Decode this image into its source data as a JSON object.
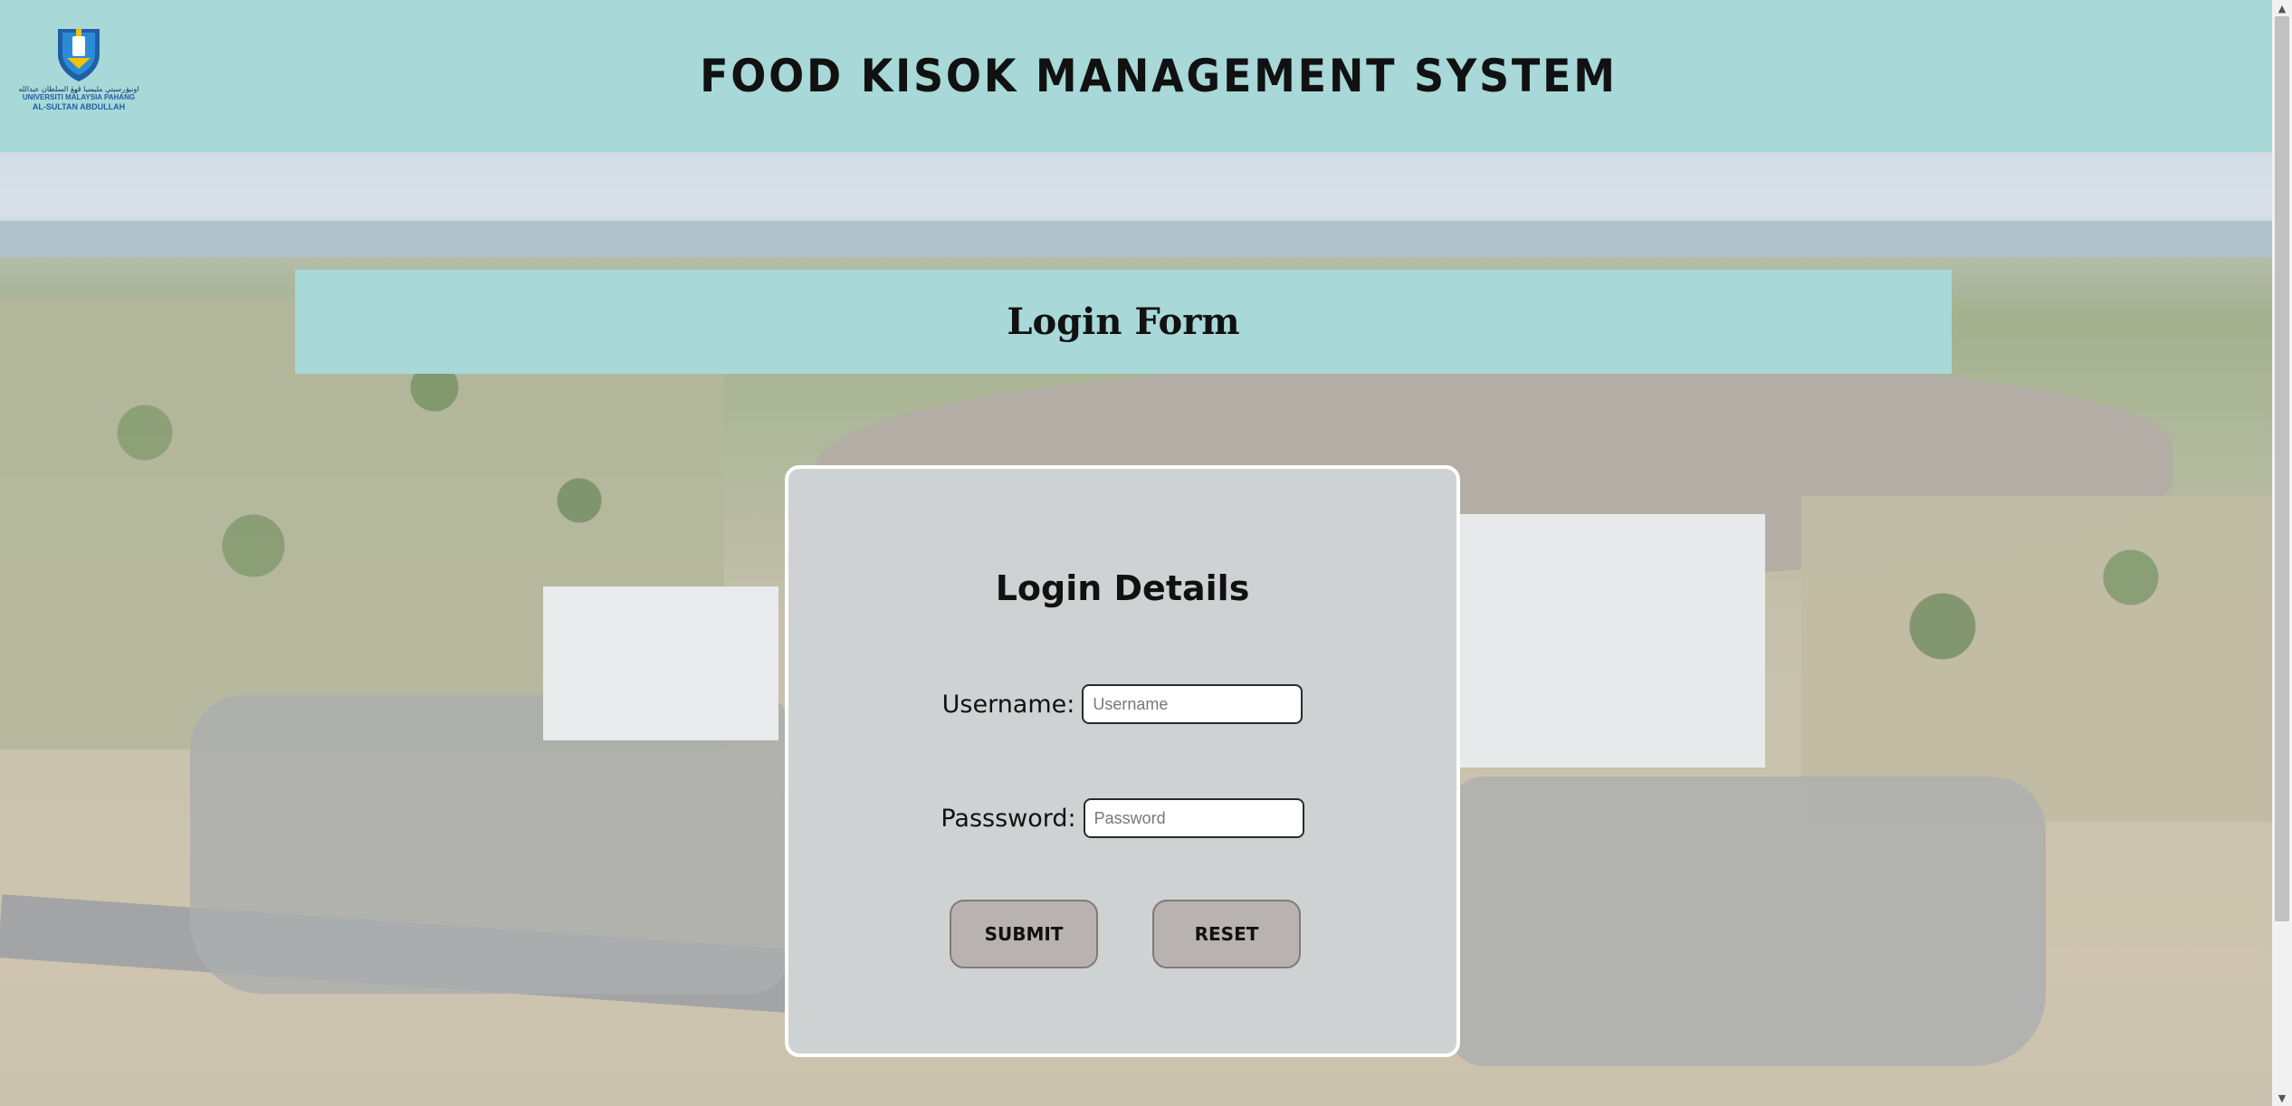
{
  "header": {
    "title": "FOOD KISOK MANAGEMENT SYSTEM",
    "logo": {
      "arabic_text": "اونيۏرسيتي مليسيا ڤهڠ السلطان عبدالله",
      "line1": "UNIVERSITI MALAYSIA PAHANG",
      "line2": "AL-SULTAN ABDULLAH"
    }
  },
  "banner": {
    "title": "Login Form"
  },
  "login": {
    "heading": "Login Details",
    "username": {
      "label": "Username:",
      "placeholder": "Username",
      "value": ""
    },
    "password": {
      "label": "Passsword:",
      "placeholder": "Password",
      "value": ""
    },
    "submit_label": "SUBMIT",
    "reset_label": "RESET"
  },
  "colors": {
    "header_bg": "#a8d8d8",
    "card_bg": "#cfd2d2",
    "button_bg": "#b8b2b1",
    "logo_blue": "#1f5fa6"
  },
  "icons": {
    "logo": "university-shield-logo",
    "scroll_up": "scroll-up-arrow-icon",
    "scroll_down": "scroll-down-arrow-icon"
  }
}
